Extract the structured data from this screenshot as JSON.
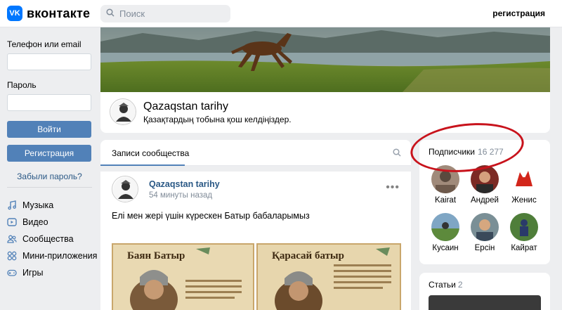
{
  "header": {
    "logo_text": "вконтакте",
    "logo_badge": "VK",
    "search_placeholder": "Поиск",
    "register_link": "регистрация"
  },
  "login": {
    "phone_label": "Телефон или email",
    "password_label": "Пароль",
    "login_button": "Войти",
    "register_button": "Регистрация",
    "forgot_link": "Забыли пароль?"
  },
  "menu": {
    "items": [
      {
        "label": "Музыка",
        "icon": "music-icon"
      },
      {
        "label": "Видео",
        "icon": "video-icon"
      },
      {
        "label": "Сообщества",
        "icon": "communities-icon"
      },
      {
        "label": "Мини-приложения",
        "icon": "apps-icon"
      },
      {
        "label": "Игры",
        "icon": "games-icon"
      }
    ]
  },
  "group": {
    "name": "Qazaqstan tarihy",
    "status": "Қазақтардың тобына қош келдіңіздер."
  },
  "wall": {
    "tab_label": "Записи сообщества"
  },
  "post": {
    "author": "Qazaqstan tarihy",
    "time": "54 минуты назад",
    "text": "Елі мен жері үшін күрескен Батыр бабаларымыз",
    "images": [
      {
        "title": "Баян Батыр"
      },
      {
        "title": "Қарасай батыр"
      }
    ]
  },
  "subscribers": {
    "title": "Подписчики",
    "count": "16 277",
    "people": [
      {
        "name": "Kairat"
      },
      {
        "name": "Андрей"
      },
      {
        "name": "Женис"
      },
      {
        "name": "Кусаин"
      },
      {
        "name": "Ерсін"
      },
      {
        "name": "Кайрат"
      }
    ]
  },
  "articles": {
    "title": "Статьи",
    "count": "2"
  },
  "colors": {
    "accent": "#5181b8",
    "link": "#2a5885",
    "brand": "#0077ff",
    "annotation": "#c8131c",
    "background": "#edeef0"
  }
}
